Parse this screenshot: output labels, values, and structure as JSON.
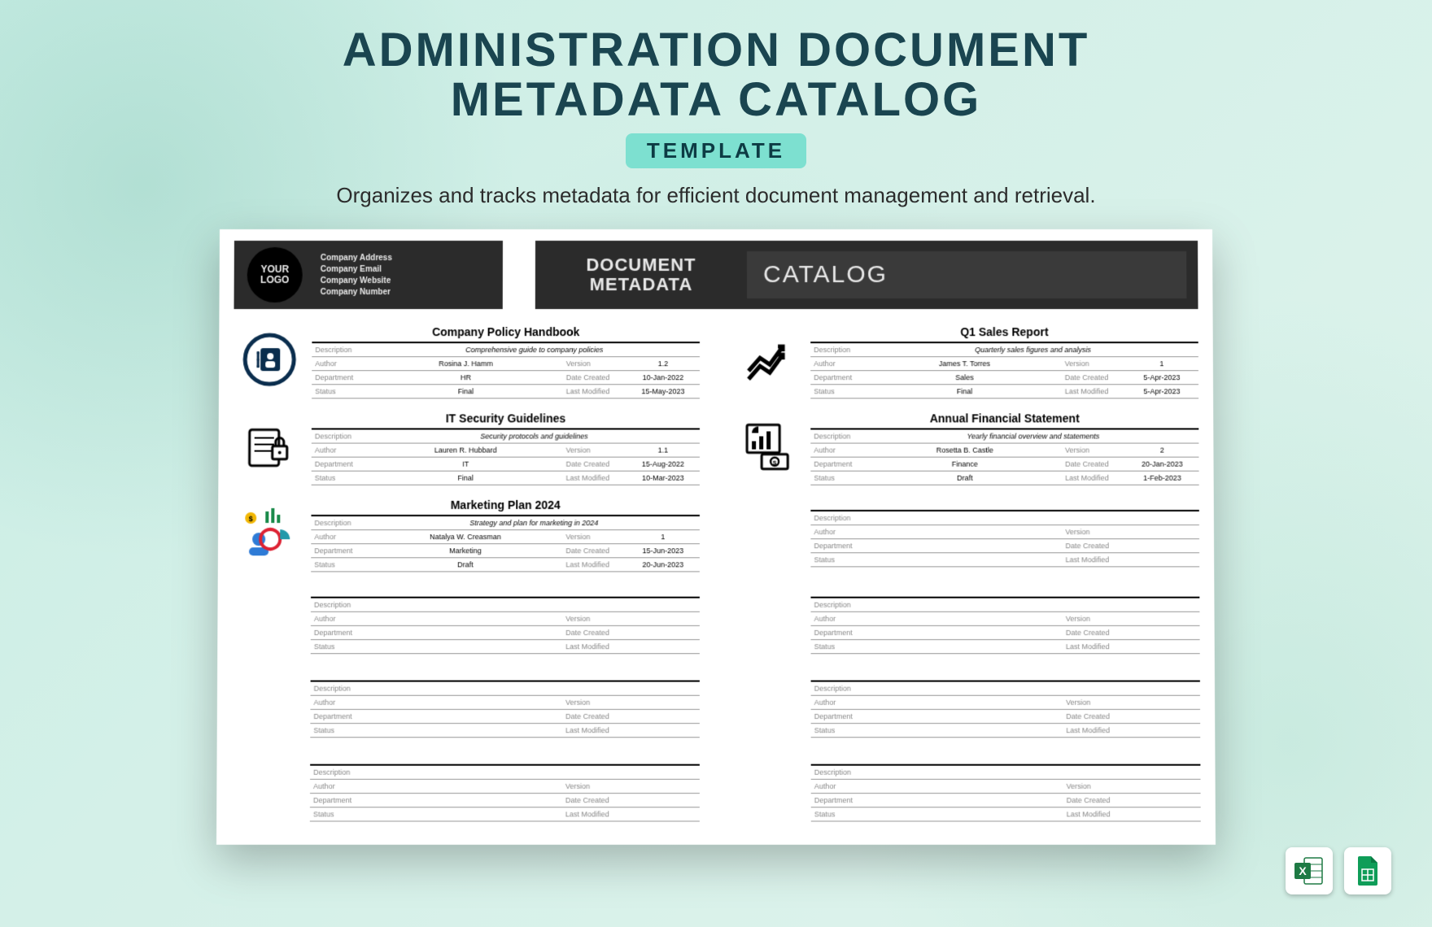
{
  "page": {
    "title_line1": "ADMINISTRATION DOCUMENT",
    "title_line2": "METADATA CATALOG",
    "badge": "TEMPLATE",
    "subtitle": "Organizes and tracks metadata for efficient document management and retrieval."
  },
  "header": {
    "logo_text": "YOUR LOGO",
    "company_fields": [
      "Company Address",
      "Company Email",
      "Company Website",
      "Company Number"
    ],
    "doc_metadata_label": "DOCUMENT METADATA",
    "catalog_label": "CATALOG"
  },
  "field_labels": {
    "description": "Description",
    "author": "Author",
    "department": "Department",
    "status": "Status",
    "version": "Version",
    "date_created": "Date Created",
    "last_modified": "Last Modified"
  },
  "entries": [
    {
      "icon": "handbook",
      "title": "Company Policy Handbook",
      "description": "Comprehensive guide to company policies",
      "author": "Rosina J. Hamm",
      "department": "HR",
      "status": "Final",
      "version": "1.2",
      "date_created": "10-Jan-2022",
      "last_modified": "15-May-2023"
    },
    {
      "icon": "chart",
      "title": "Q1 Sales Report",
      "description": "Quarterly sales figures and analysis",
      "author": "James T. Torres",
      "department": "Sales",
      "status": "Final",
      "version": "1",
      "date_created": "5-Apr-2023",
      "last_modified": "5-Apr-2023"
    },
    {
      "icon": "security",
      "title": "IT Security Guidelines",
      "description": "Security protocols and guidelines",
      "author": "Lauren R. Hubbard",
      "department": "IT",
      "status": "Final",
      "version": "1.1",
      "date_created": "15-Aug-2022",
      "last_modified": "10-Mar-2023"
    },
    {
      "icon": "finance",
      "title": "Annual Financial Statement",
      "description": "Yearly financial overview and statements",
      "author": "Rosetta B. Castle",
      "department": "Finance",
      "status": "Draft",
      "version": "2",
      "date_created": "20-Jan-2023",
      "last_modified": "1-Feb-2023"
    },
    {
      "icon": "marketing",
      "title": "Marketing Plan 2024",
      "description": "Strategy and plan for marketing in 2024",
      "author": "Natalya W. Creasman",
      "department": "Marketing",
      "status": "Draft",
      "version": "1",
      "date_created": "15-Jun-2023",
      "last_modified": "20-Jun-2023"
    },
    {
      "icon": "",
      "title": "",
      "description": "",
      "author": "",
      "department": "",
      "status": "",
      "version": "",
      "date_created": "",
      "last_modified": ""
    },
    {
      "icon": "",
      "title": "",
      "description": "",
      "author": "",
      "department": "",
      "status": "",
      "version": "",
      "date_created": "",
      "last_modified": ""
    },
    {
      "icon": "",
      "title": "",
      "description": "",
      "author": "",
      "department": "",
      "status": "",
      "version": "",
      "date_created": "",
      "last_modified": ""
    },
    {
      "icon": "",
      "title": "",
      "description": "",
      "author": "",
      "department": "",
      "status": "",
      "version": "",
      "date_created": "",
      "last_modified": ""
    },
    {
      "icon": "",
      "title": "",
      "description": "",
      "author": "",
      "department": "",
      "status": "",
      "version": "",
      "date_created": "",
      "last_modified": ""
    },
    {
      "icon": "",
      "title": "",
      "description": "",
      "author": "",
      "department": "",
      "status": "",
      "version": "",
      "date_created": "",
      "last_modified": ""
    },
    {
      "icon": "",
      "title": "",
      "description": "",
      "author": "",
      "department": "",
      "status": "",
      "version": "",
      "date_created": "",
      "last_modified": ""
    }
  ],
  "format_icons": {
    "excel": "Excel",
    "sheets": "Google Sheets"
  }
}
